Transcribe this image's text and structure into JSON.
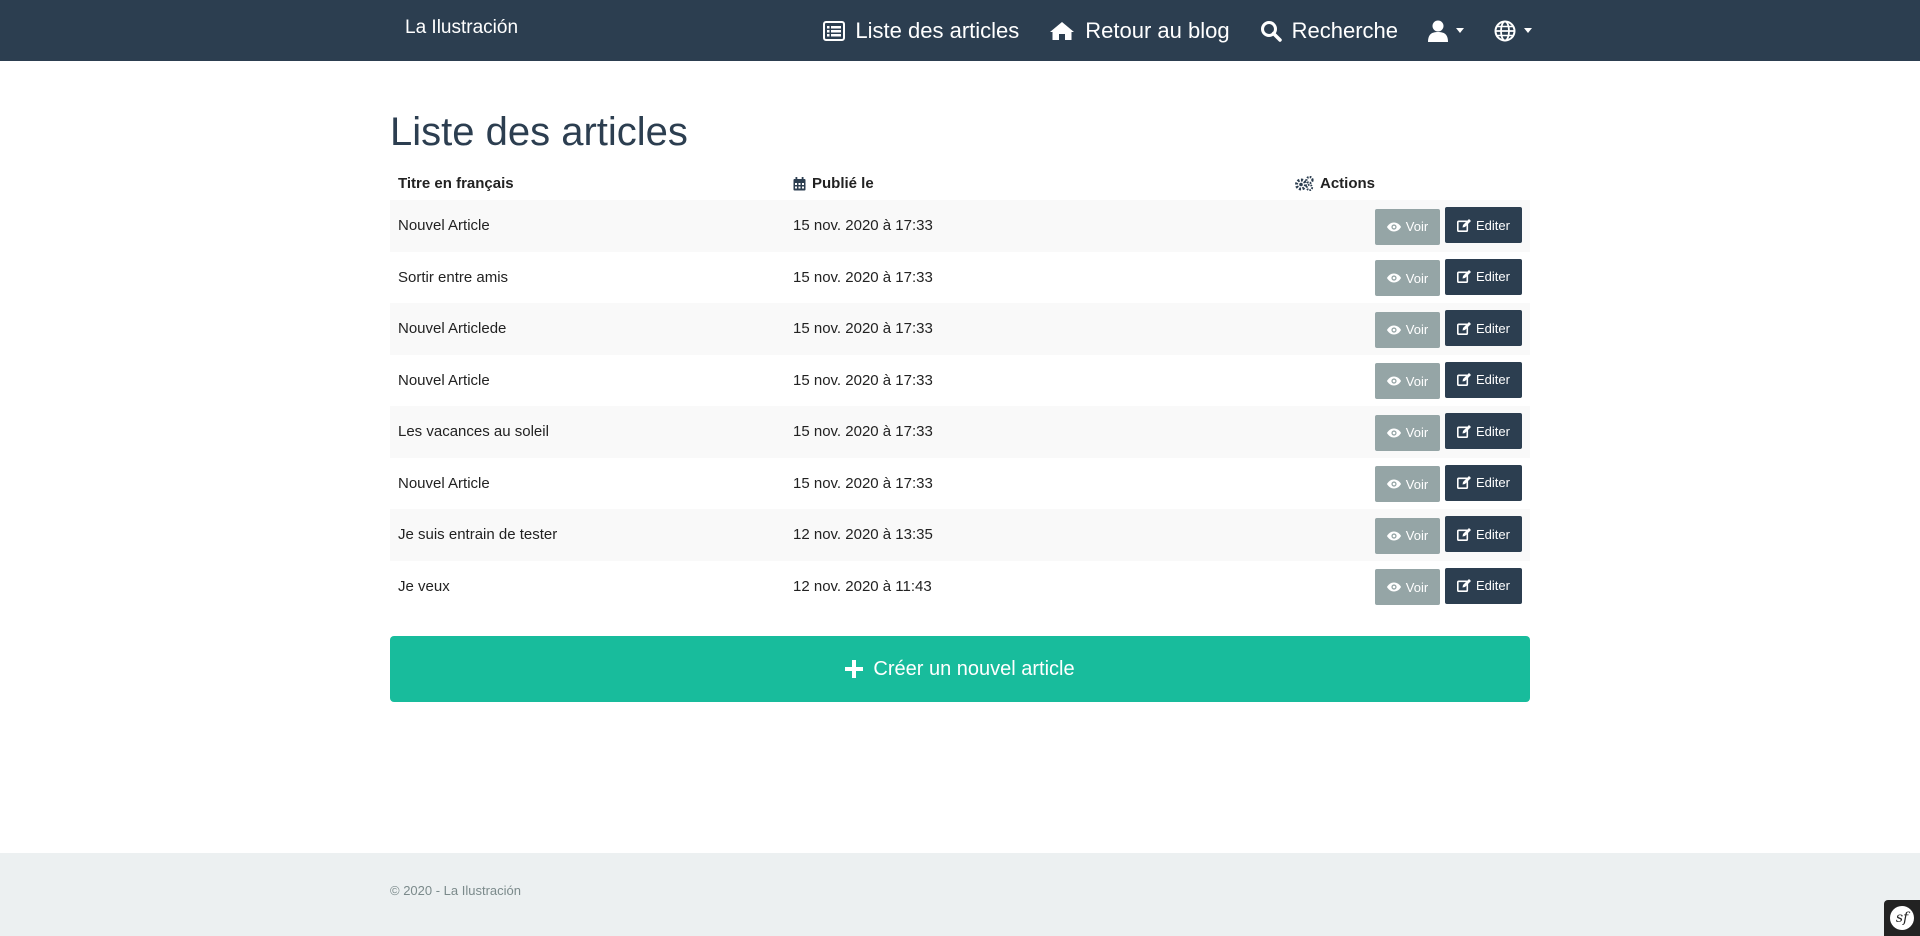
{
  "navbar": {
    "brand": "La Ilustración",
    "links": [
      {
        "label": "Liste des articles",
        "icon": "list-icon"
      },
      {
        "label": "Retour au blog",
        "icon": "home-icon"
      },
      {
        "label": "Recherche",
        "icon": "search-icon"
      }
    ],
    "user_menu_icon": "user-icon",
    "language_menu_icon": "globe-icon"
  },
  "page": {
    "title": "Liste des articles"
  },
  "table": {
    "headers": {
      "title": "Titre en français",
      "published": "Publié le",
      "actions": "Actions"
    },
    "view_label": "Voir",
    "edit_label": "Editer",
    "rows": [
      {
        "title": "Nouvel Article",
        "published": "15 nov. 2020 à 17:33"
      },
      {
        "title": "Sortir entre amis",
        "published": "15 nov. 2020 à 17:33"
      },
      {
        "title": "Nouvel Articlede",
        "published": "15 nov. 2020 à 17:33"
      },
      {
        "title": "Nouvel Article",
        "published": "15 nov. 2020 à 17:33"
      },
      {
        "title": "Les vacances au soleil",
        "published": "15 nov. 2020 à 17:33"
      },
      {
        "title": "Nouvel Article",
        "published": "15 nov. 2020 à 17:33"
      },
      {
        "title": "Je suis entrain de tester",
        "published": "12 nov. 2020 à 13:35"
      },
      {
        "title": "Je veux",
        "published": "12 nov. 2020 à 11:43"
      }
    ]
  },
  "create_button": {
    "label": "Créer un nouvel article"
  },
  "footer": {
    "text": "© 2020 - La Ilustración"
  },
  "debug_toolbar": {
    "logo_text": "sf"
  },
  "colors": {
    "navbar": "#2c3e50",
    "primary": "#2c3e50",
    "secondary": "#95a5a6",
    "success": "#18bc9c",
    "footer_bg": "#ecf0f1"
  }
}
